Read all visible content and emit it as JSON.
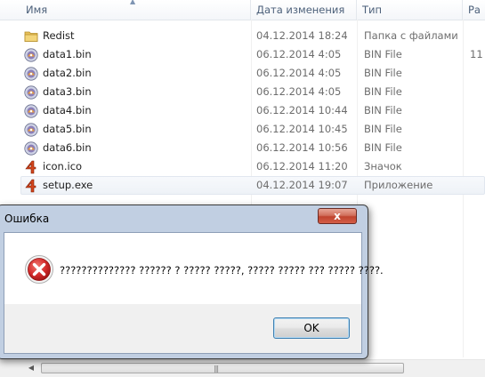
{
  "columns": {
    "name": "Имя",
    "date": "Дата изменения",
    "type": "Тип",
    "size": "Ра"
  },
  "files": [
    {
      "name": "Redist",
      "date": "04.12.2014 18:24",
      "type": "Папка с файлами",
      "size": "",
      "icon": "folder-icon"
    },
    {
      "name": "data1.bin",
      "date": "06.12.2014 4:05",
      "type": "BIN File",
      "size": "11",
      "icon": "bin-file-icon"
    },
    {
      "name": "data2.bin",
      "date": "06.12.2014 4:05",
      "type": "BIN File",
      "size": "",
      "icon": "bin-file-icon"
    },
    {
      "name": "data3.bin",
      "date": "06.12.2014 4:05",
      "type": "BIN File",
      "size": "",
      "icon": "bin-file-icon"
    },
    {
      "name": "data4.bin",
      "date": "06.12.2014 10:44",
      "type": "BIN File",
      "size": "",
      "icon": "bin-file-icon"
    },
    {
      "name": "data5.bin",
      "date": "06.12.2014 10:45",
      "type": "BIN File",
      "size": "",
      "icon": "bin-file-icon"
    },
    {
      "name": "data6.bin",
      "date": "06.12.2014 10:56",
      "type": "BIN File",
      "size": "",
      "icon": "bin-file-icon"
    },
    {
      "name": "icon.ico",
      "date": "06.12.2014 11:20",
      "type": "Значок",
      "size": "",
      "icon": "app-4-icon"
    },
    {
      "name": "setup.exe",
      "date": "04.12.2014 19:07",
      "type": "Приложение",
      "size": "",
      "icon": "app-4-icon"
    }
  ],
  "dialog": {
    "title": "Ошибка",
    "close_label": "x",
    "message": "?????????????? ?????? ? ????? ?????, ????? ????? ??? ????? ????.",
    "ok_label": "OK"
  },
  "colors": {
    "dialog_frame": "#becde1",
    "error_red": "#c8282a",
    "close_red": "#c0432e"
  }
}
